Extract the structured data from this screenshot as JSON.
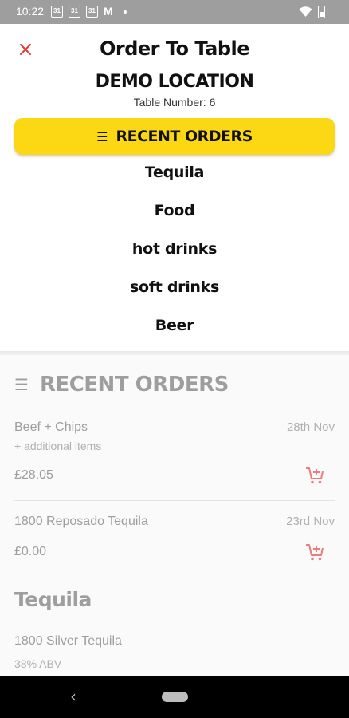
{
  "status_bar": {
    "time": "10:22",
    "calendar_icon_text": "31",
    "gmail_icon_text": "M"
  },
  "header": {
    "title": "Order To Table",
    "location": "DEMO LOCATION",
    "table_number": "Table Number: 6"
  },
  "menu": {
    "recent_orders_label": "RECENT ORDERS",
    "categories": [
      "Tequila",
      "Food",
      "hot drinks",
      "soft drinks",
      "Beer"
    ]
  },
  "recent_orders_section": {
    "title": "RECENT ORDERS",
    "orders": [
      {
        "name": "Beef + Chips",
        "date": "28th Nov",
        "extra": "+ additional items",
        "price": "£28.05"
      },
      {
        "name": "1800 Reposado Tequila",
        "date": "23rd Nov",
        "price": "£0.00"
      }
    ]
  },
  "tequila_section": {
    "title": "Tequila",
    "products": [
      {
        "name": "1800 Silver Tequila",
        "abv": "38% ABV"
      }
    ]
  },
  "colors": {
    "accent_yellow": "#fcd814",
    "close_red": "#e53935",
    "cart_red": "#ef7a7a",
    "muted_text": "#9e9e9e"
  },
  "icons": {
    "close": "close-icon",
    "menu": "hamburger-menu-icon",
    "cart": "add-to-cart-icon",
    "back": "back-chevron-icon",
    "home": "home-pill-icon"
  }
}
